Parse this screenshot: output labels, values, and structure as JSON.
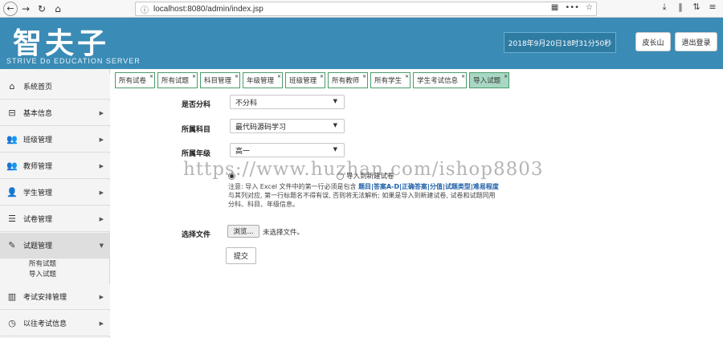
{
  "browser": {
    "url": "localhost:8080/admin/index.jsp",
    "icons": [
      "back-icon",
      "forward-icon",
      "reload-icon",
      "home-icon",
      "info-icon",
      "qr-icon",
      "more-icon",
      "star-icon",
      "download-icon",
      "library-icon",
      "sidebar-icon",
      "menu-icon"
    ]
  },
  "header": {
    "logo_cn": "智夫子",
    "logo_en": "STRIVE Do EDUCATION SERVER",
    "datetime": "2018年9月20日18时31分50秒",
    "user_button": "皮长山",
    "logout_button": "退出登录",
    "background": "#3a8bb5"
  },
  "sidebar": {
    "items": [
      {
        "label": "系统首页",
        "icon": "home-icon",
        "has_caret": false
      },
      {
        "label": "基本信息",
        "icon": "info-box-icon",
        "has_caret": true
      },
      {
        "label": "班级管理",
        "icon": "users-icon",
        "has_caret": true
      },
      {
        "label": "教师管理",
        "icon": "users-icon",
        "has_caret": true
      },
      {
        "label": "学生管理",
        "icon": "user-icon",
        "has_caret": true
      },
      {
        "label": "试卷管理",
        "icon": "paper-icon",
        "has_caret": true
      },
      {
        "label": "试题管理",
        "icon": "edit-icon",
        "has_caret": true,
        "active": true,
        "sub_items": [
          "所有试题",
          "导入试题"
        ]
      },
      {
        "label": "考试安排管理",
        "icon": "books-icon",
        "has_caret": true
      },
      {
        "label": "以往考试信息",
        "icon": "clock-icon",
        "has_caret": true
      }
    ]
  },
  "tabs": [
    {
      "label": "所有试卷"
    },
    {
      "label": "所有试题"
    },
    {
      "label": "科目管理"
    },
    {
      "label": "年级管理"
    },
    {
      "label": "班级管理"
    },
    {
      "label": "所有教师"
    },
    {
      "label": "所有学生"
    },
    {
      "label": "学生考试信息"
    },
    {
      "label": "导入试题",
      "active": true
    }
  ],
  "form": {
    "split_subject": {
      "label": "是否分科",
      "value": "不分科"
    },
    "subject": {
      "label": "所属科目",
      "value": "最代码源码学习"
    },
    "grade": {
      "label": "所属年级",
      "value": "高一"
    },
    "import_radio_new": "导入到新建试卷",
    "note_prefix": "注意: 导入 Excel 文件中的第一行必须是包含 ",
    "note_emph": "题目|答案A-D|正确答案|分值|试题类型|难易程度",
    "note_suffix": " 与其列对应, 第一行标题名不得有误, 否则将无法解析; 如果是导入到新建试卷, 试卷和试题同用 分科、科目、年级信息。",
    "file_label": "选择文件",
    "file_button": "浏览...",
    "file_status": "未选择文件。",
    "submit": "提交"
  },
  "watermark": "https://www.huzhan.com/ishop8803"
}
